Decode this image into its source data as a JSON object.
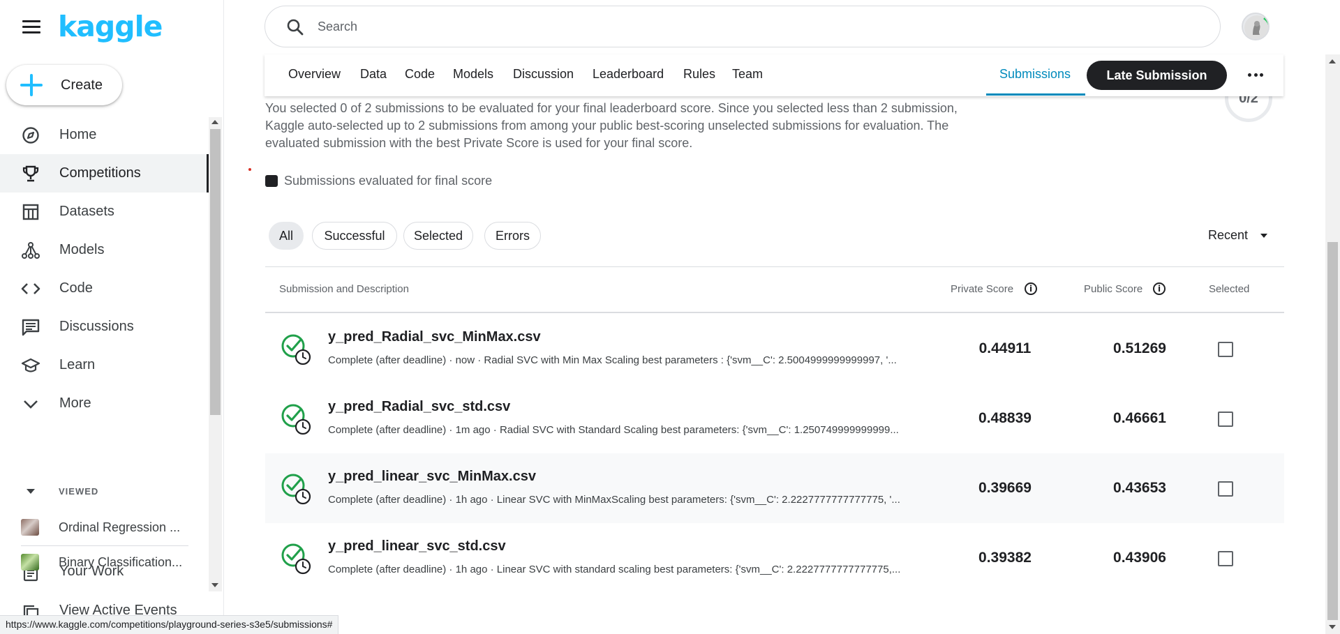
{
  "brand": {
    "logo_text": "kaggle",
    "accent": "#20beff"
  },
  "sidebar": {
    "create_label": "Create",
    "items": [
      {
        "label": "Home",
        "icon": "compass-icon"
      },
      {
        "label": "Competitions",
        "icon": "trophy-icon",
        "active": true
      },
      {
        "label": "Datasets",
        "icon": "table-icon"
      },
      {
        "label": "Models",
        "icon": "model-icon"
      },
      {
        "label": "Code",
        "icon": "code-icon"
      },
      {
        "label": "Discussions",
        "icon": "discussion-icon"
      },
      {
        "label": "Learn",
        "icon": "school-icon"
      },
      {
        "label": "More",
        "icon": "chevron-down-icon"
      }
    ],
    "your_work": "Your Work",
    "viewed_heading": "VIEWED",
    "viewed": [
      {
        "label": "Ordinal Regression ..."
      },
      {
        "label": "Binary Classification..."
      }
    ],
    "view_active_events": "View Active Events"
  },
  "search": {
    "placeholder": "Search"
  },
  "tabs": {
    "items": [
      "Overview",
      "Data",
      "Code",
      "Models",
      "Discussion",
      "Leaderboard",
      "Rules",
      "Team"
    ],
    "submissions": "Submissions",
    "late_submission": "Late Submission"
  },
  "selection": {
    "counter": "0/2",
    "explanation": "You selected 0 of 2 submissions to be evaluated for your final leaderboard score. Since you selected less than 2 submission, Kaggle auto-selected up to 2 submissions from among your public best-scoring unselected submissions for evaluation. The evaluated submission with the best Private Score is used for your final score.",
    "legend": "Submissions evaluated for final score"
  },
  "filters": {
    "chips": [
      "All",
      "Successful",
      "Selected",
      "Errors"
    ],
    "active": "All",
    "sort": "Recent"
  },
  "table": {
    "headers": {
      "submission": "Submission and Description",
      "private": "Private Score",
      "public": "Public Score",
      "selected": "Selected"
    },
    "rows": [
      {
        "file": "y_pred_Radial_svc_MinMax.csv",
        "desc": "Complete (after deadline) · now · Radial SVC with Min Max Scaling best parameters : {'svm__C': 2.5004999999999997, '...",
        "private": "0.44911",
        "public": "0.51269",
        "selected": false
      },
      {
        "file": "y_pred_Radial_svc_std.csv",
        "desc": "Complete (after deadline) · 1m ago · Radial SVC with Standard Scaling best parameters: {'svm__C': 1.250749999999999...",
        "private": "0.48839",
        "public": "0.46661",
        "selected": false
      },
      {
        "file": "y_pred_linear_svc_MinMax.csv",
        "desc": "Complete (after deadline) · 1h ago · Linear SVC with MinMaxScaling best parameters: {'svm__C': 2.2227777777777775, '...",
        "private": "0.39669",
        "public": "0.43653",
        "selected": false
      },
      {
        "file": "y_pred_linear_svc_std.csv",
        "desc": "Complete (after deadline) · 1h ago · Linear SVC with standard scaling best parameters: {'svm__C': 2.2227777777777775,...",
        "private": "0.39382",
        "public": "0.43906",
        "selected": false
      }
    ]
  },
  "status_url": "https://www.kaggle.com/competitions/playground-series-s3e5/submissions#"
}
